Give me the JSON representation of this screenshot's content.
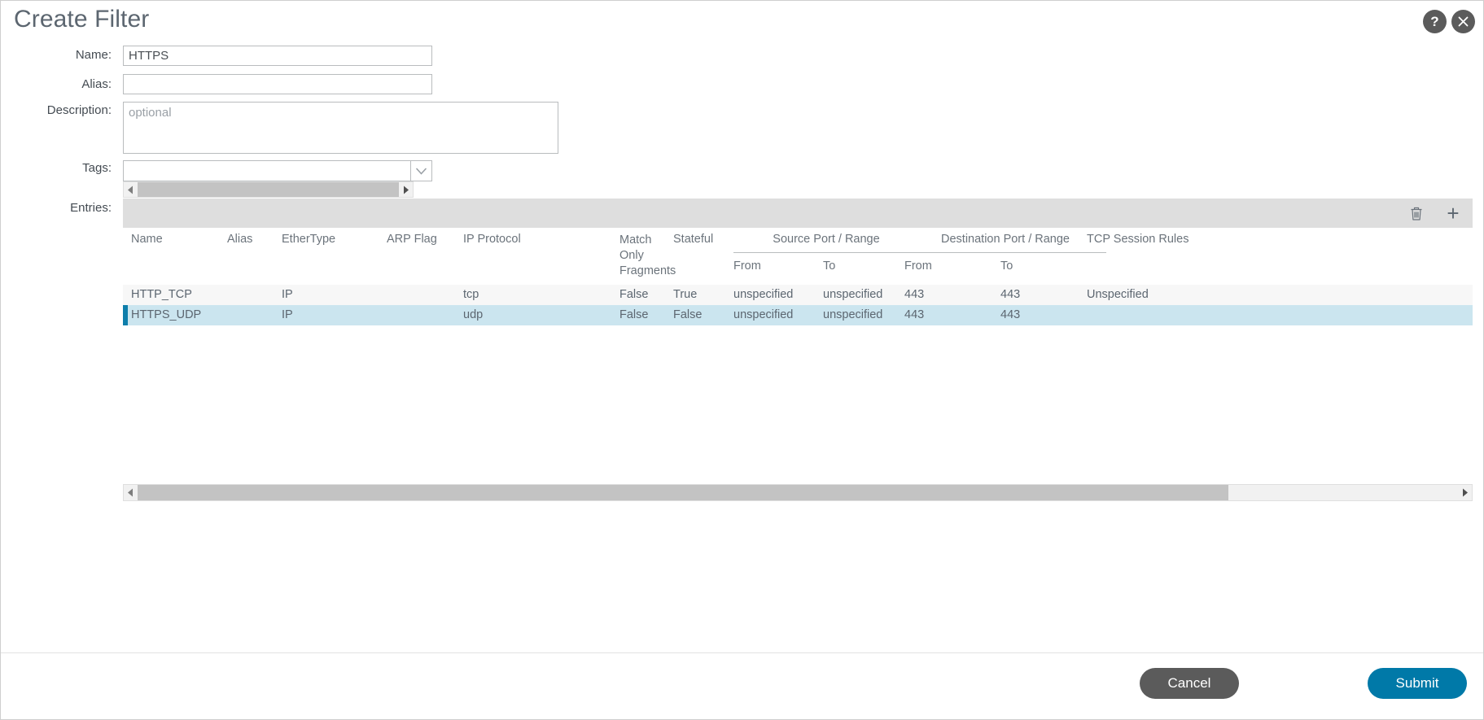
{
  "dialog": {
    "title": "Create Filter",
    "help_icon": "help-icon",
    "help_glyph": "?",
    "close_icon": "close-icon"
  },
  "form": {
    "name": {
      "label": "Name:",
      "value": "HTTPS",
      "placeholder": ""
    },
    "alias": {
      "label": "Alias:",
      "value": "",
      "placeholder": ""
    },
    "description": {
      "label": "Description:",
      "value": "",
      "placeholder": "optional"
    },
    "tags": {
      "label": "Tags:",
      "value": "",
      "placeholder": "",
      "chevron_icon": "chevron-down-icon"
    },
    "entries": {
      "label": "Entries:"
    }
  },
  "toolbar": {
    "delete_icon": "trash-icon",
    "add_icon": "plus-icon",
    "add_glyph": "+"
  },
  "table": {
    "headers": {
      "name": "Name",
      "alias": "Alias",
      "ethertype": "EtherType",
      "arp_flag": "ARP Flag",
      "ip_protocol": "IP Protocol",
      "match_only_fragments": "Match Only Fragments",
      "stateful": "Stateful",
      "source_port_range": "Source Port / Range",
      "destination_port_range": "Destination Port / Range",
      "tcp_session_rules": "TCP Session Rules",
      "src_from": "From",
      "src_to": "To",
      "dst_from": "From",
      "dst_to": "To"
    },
    "rows": [
      {
        "name": "HTTP_TCP",
        "alias": "",
        "ethertype": "IP",
        "arp_flag": "",
        "ip_protocol": "tcp",
        "match_only_fragments": "False",
        "stateful": "True",
        "src_from": "unspecified",
        "src_to": "unspecified",
        "dst_from": "443",
        "dst_to": "443",
        "tcp_session_rules": "Unspecified",
        "selected": false
      },
      {
        "name": "HTTPS_UDP",
        "alias": "",
        "ethertype": "IP",
        "arp_flag": "",
        "ip_protocol": "udp",
        "match_only_fragments": "False",
        "stateful": "False",
        "src_from": "unspecified",
        "src_to": "unspecified",
        "dst_from": "443",
        "dst_to": "443",
        "tcp_session_rules": "",
        "selected": true
      }
    ]
  },
  "scrollbars": {
    "left_arrow_icon": "scroll-left-arrow-icon",
    "right_arrow_icon": "scroll-right-arrow-icon"
  },
  "footer": {
    "cancel_label": "Cancel",
    "submit_label": "Submit"
  },
  "colors": {
    "accent": "#0079a8",
    "selected_row": "#cbe5ef",
    "selected_bar": "#0e7eab",
    "toolbar_band": "#dedede",
    "cancel_button": "#5b5b5b",
    "text": "#5c6670"
  }
}
